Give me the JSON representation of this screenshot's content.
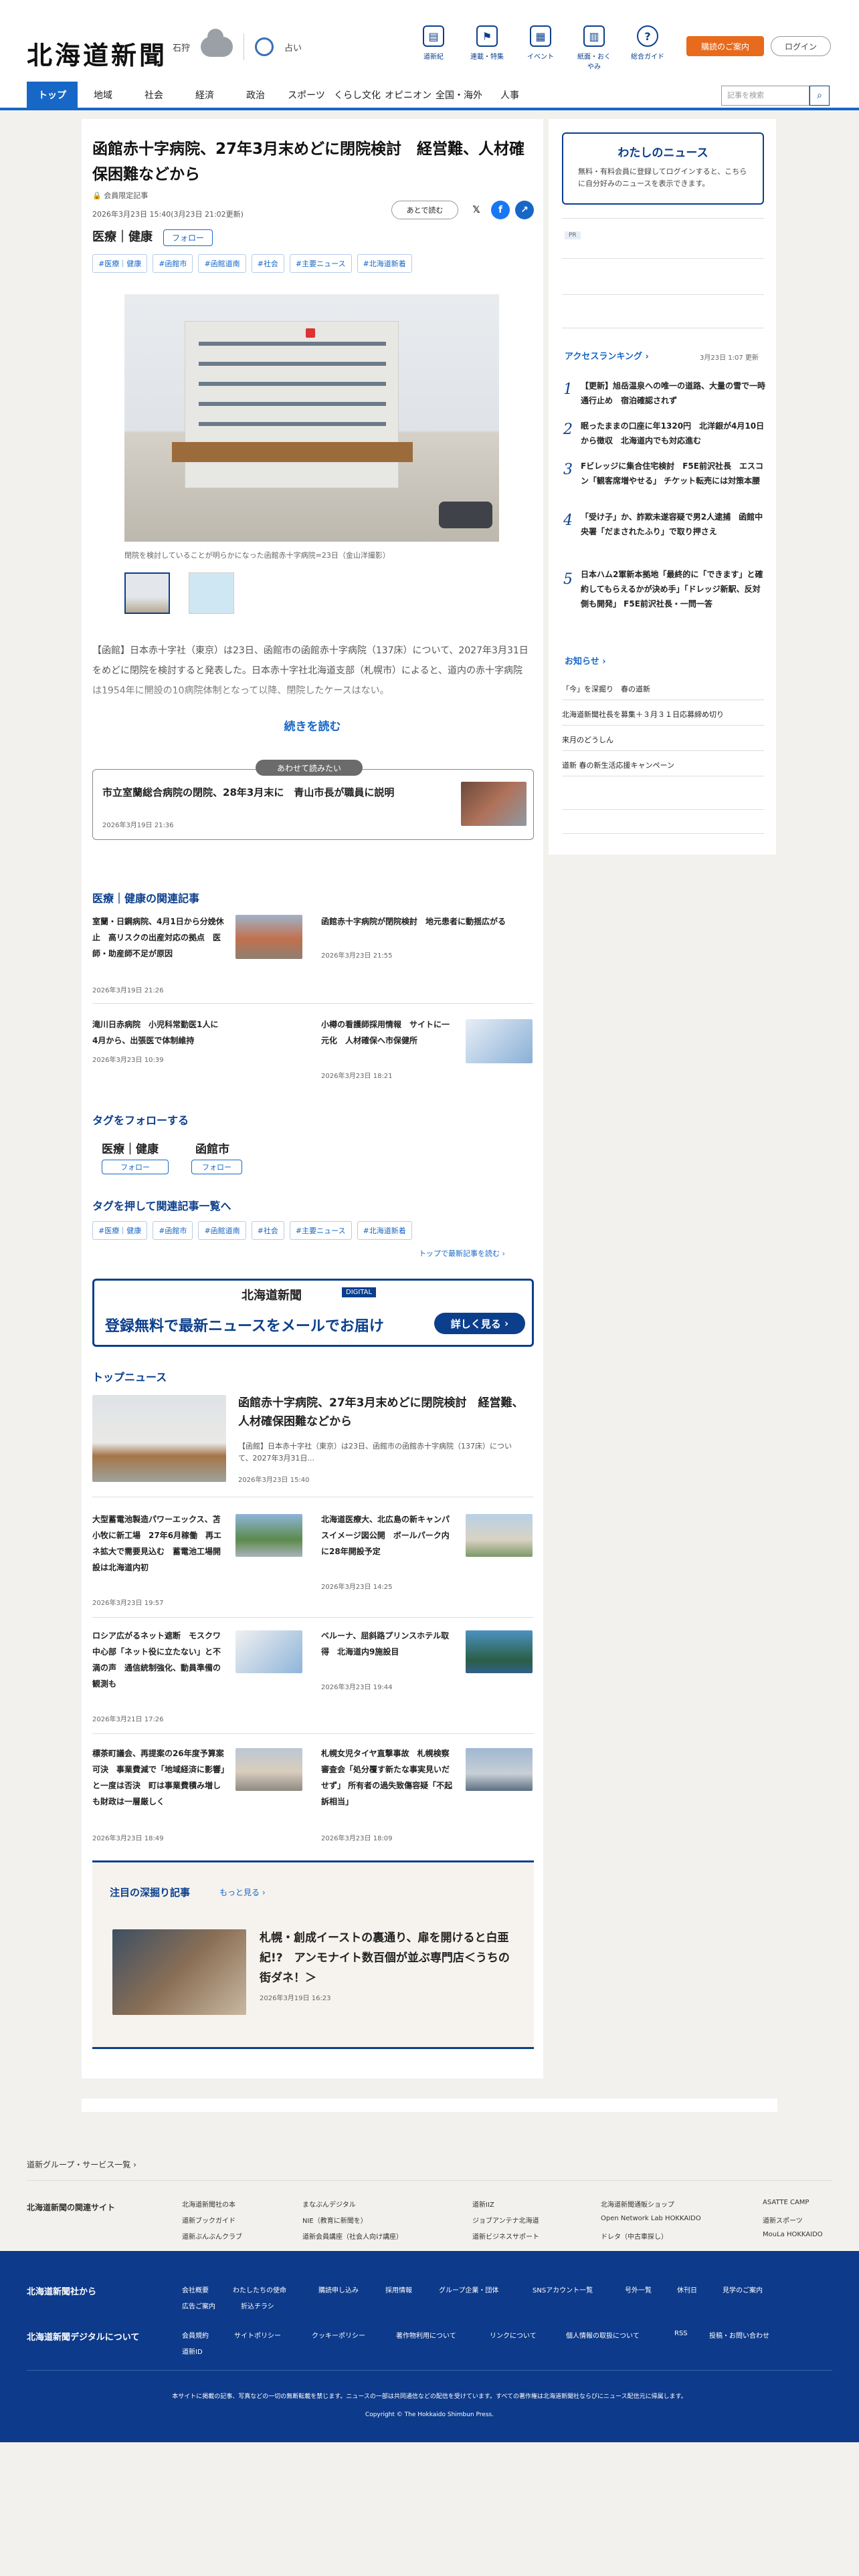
{
  "header": {
    "logo": "北海道新聞",
    "location": "石狩",
    "weather_text": "占い",
    "icons": [
      {
        "label": "道新紀",
        "name": "book"
      },
      {
        "label": "連載・特集",
        "name": "flag"
      },
      {
        "label": "イベント",
        "name": "calendar"
      },
      {
        "label": "紙面・おくやみ",
        "name": "paper"
      },
      {
        "label": "総合ガイド",
        "name": "help"
      }
    ],
    "info_btn": "購読のご案内",
    "login_btn": "ログイン"
  },
  "nav": [
    "トップ",
    "地域",
    "社会",
    "経済",
    "政治",
    "スポーツ",
    "くらし文化",
    "オピニオン",
    "全国・海外",
    "人事"
  ],
  "search_placeholder": "記事を検索",
  "article": {
    "title": "函館赤十字病院、27年3月末めどに閉院検討　経営難、人材確保困難などから",
    "member": "会員限定記事",
    "date": "2026年3月23日 15:40(3月23日 21:02更新)",
    "later": "あとで読む",
    "category": "医療｜健康",
    "follow": "フォロー",
    "tags": [
      "#医療｜健康",
      "#函館市",
      "#函館道南",
      "#社会",
      "#主要ニュース",
      "#北海道新着"
    ],
    "caption": "閉院を検討していることが明らかになった函館赤十字病院=23日（金山洋撮影）",
    "lead": "【函館】日本赤十字社（東京）は23日、函館市の函館赤十字病院（137床）について、2027年3月31日をめどに閉院を検討すると発表した。日本赤十字社北海道支部（札幌市）によると、道内の赤十字病院は1954年に開設の10病院体制となって以降、閉院したケースはない。",
    "more": "続きを読む"
  },
  "recommend": {
    "label": "あわせて読みたい",
    "title": "市立室蘭総合病院の閉院、28年3月末に　青山市長が職員に説明",
    "date": "2026年3月19日 21:36"
  },
  "related": {
    "heading": "医療｜健康の関連記事",
    "items": [
      {
        "title": "室蘭・日鋼病院、4月1日から分娩休止　高リスクの出産対応の拠点　医師・助産師不足が原因",
        "date": "2026年3月19日 21:26"
      },
      {
        "title": "函館赤十字病院が閉院検討　地元患者に動揺広がる",
        "date": "2026年3月23日 21:55"
      },
      {
        "title": "滝川日赤病院　小児科常勤医1人に　4月から、出張医で体制維持",
        "date": "2026年3月23日 10:39"
      },
      {
        "title": "小樽の看護師採用情報　サイトに一元化　人材確保へ市保健所",
        "date": "2026年3月23日 18:21"
      }
    ]
  },
  "follow_tags": {
    "heading": "タグをフォローする",
    "items": [
      "医療｜健康",
      "函館市"
    ],
    "btn": "フォロー"
  },
  "tag_list": {
    "heading": "タグを押して関連記事一覧へ",
    "link": "トップで最新記事を読む"
  },
  "banner": {
    "logo": "北海道新聞",
    "digital": "DIGITAL",
    "text": "登録無料で最新ニュースをメールでお届け",
    "btn": "詳しく見る"
  },
  "top_news": {
    "heading": "トップニュース",
    "main": {
      "title": "函館赤十字病院、27年3月末めどに閉院検討　経営難、人材確保困難などから",
      "lead": "【函館】日本赤十字社（東京）は23日、函館市の函館赤十字病院（137床）について、2027年3月31日...",
      "date": "2026年3月23日 15:40"
    },
    "items": [
      {
        "title": "大型蓄電池製造パワーエックス、苫小牧に新工場　27年6月稼働　再エネ拡大で需要見込む　蓄電池工場開設は北海道内初",
        "date": "2026年3月23日 19:57"
      },
      {
        "title": "北海道医療大、北広島の新キャンパスイメージ図公開　ボールパーク内に28年開設予定",
        "date": "2026年3月23日 14:25"
      },
      {
        "title": "ロシア広がるネット遮断　モスクワ中心部「ネット役に立たない」と不満の声　通信統制強化、動員準備の観測も",
        "date": "2026年3月21日 17:26"
      },
      {
        "title": "ベルーナ、屈斜路プリンスホテル取得　北海道内9施設目",
        "date": "2026年3月23日 19:44"
      },
      {
        "title": "標茶町議会、再提案の26年度予算案可決　事業費減で「地域経済に影響」と一度は否決　町は事業費積み増しも財政は一層厳しく",
        "date": "2026年3月23日 18:49"
      },
      {
        "title": "札幌女児タイヤ直撃事故　札幌検察審査会「処分覆す新たな事実見いだせず」 所有者の過失致傷容疑「不起訴相当」",
        "date": "2026年3月23日 18:09"
      }
    ]
  },
  "deep": {
    "heading": "注目の深掘り記事",
    "more": "もっと見る",
    "title": "札幌・創成イーストの裏通り、扉を開けると白亜紀!?　アンモナイト数百個が並ぶ専門店＜うちの街ダネ！＞",
    "date": "2026年3月19日 16:23"
  },
  "sidebar": {
    "my_news_title": "わたしのニュース",
    "my_news_text": "無料・有料会員に登録してログインすると、こちらに自分好みのニュースを表示できます。",
    "pr": "PR",
    "ranking_title": "アクセスランキング",
    "ranking_date": "3月23日 1:07 更新",
    "ranking": [
      "【更新】旭岳温泉への唯一の道路、大量の雪で一時通行止め　宿泊確認されず",
      "眠ったままの口座に年1320円　北洋銀が4月10日から徴収　北海道内でも対応進む",
      "Fビレッジに集合住宅検討　F5E前沢社長　エスコン「観客席増やせる」 チケット転売には対策本腰",
      "「受け子」か、詐欺未遂容疑で男2人逮捕　函館中央署「だまされたふり」で取り押さえ",
      "日本ハム2軍新本拠地「最終的に「できます」と確約してもらえるかが決め手」「ドレッジ新駅、反対側も開発」 F5E前沢社長・一問一答"
    ],
    "notice_title": "お知らせ",
    "notices": [
      "「今」を深掘り　春の道新",
      "北海道新聞社長を募集＋３月３１日応募締め切り",
      "来月のどうしん",
      "道新 春の新生活応援キャンペーン"
    ]
  },
  "footer": {
    "group": "道新グループ・サービス一覧",
    "related_title": "北海道新聞の関連サイト",
    "related": [
      "北海道新聞社の本",
      "まなぶんデジタル",
      "道新IIZ",
      "北海道新聞通販ショップ",
      "ASATTE CAMP",
      "道新ブックガイド",
      "NIE（教育に新聞を）",
      "ジョブアンテナ北海道",
      "Open Network Lab HOKKAIDO",
      "道新スポーツ",
      "道新ぶんぶんクラブ",
      "道新会員講座（社会人向け講座）",
      "道新ビジネスサポート",
      "ドレタ（中古車探し）",
      "MouLa HOKKAIDO"
    ],
    "from_company": "北海道新聞社から",
    "company_links": [
      "会社概要",
      "わたしたちの使命",
      "購読申し込み",
      "採用情報",
      "グループ企業・団体",
      "SNSアカウント一覧",
      "号外一覧",
      "休刊日",
      "見学のご案内",
      "広告ご案内",
      "折込チラシ"
    ],
    "digital_title": "北海道新聞デジタルについて",
    "digital_links": [
      "会員規約",
      "サイトポリシー",
      "クッキーポリシー",
      "著作物利用について",
      "リンクについて",
      "個人情報の取扱について",
      "RSS",
      "投稿・お問い合わせ",
      "道新ID"
    ],
    "notice": "本サイトに掲載の記事、写真などの一切の無断転載を禁じます。ニュースの一部は共同通信などの配信を受けています。すべての著作権は北海道新聞社ならびにニュース配信元に帰属します。",
    "copyright": "Copyright © The Hokkaido Shimbun Press."
  }
}
